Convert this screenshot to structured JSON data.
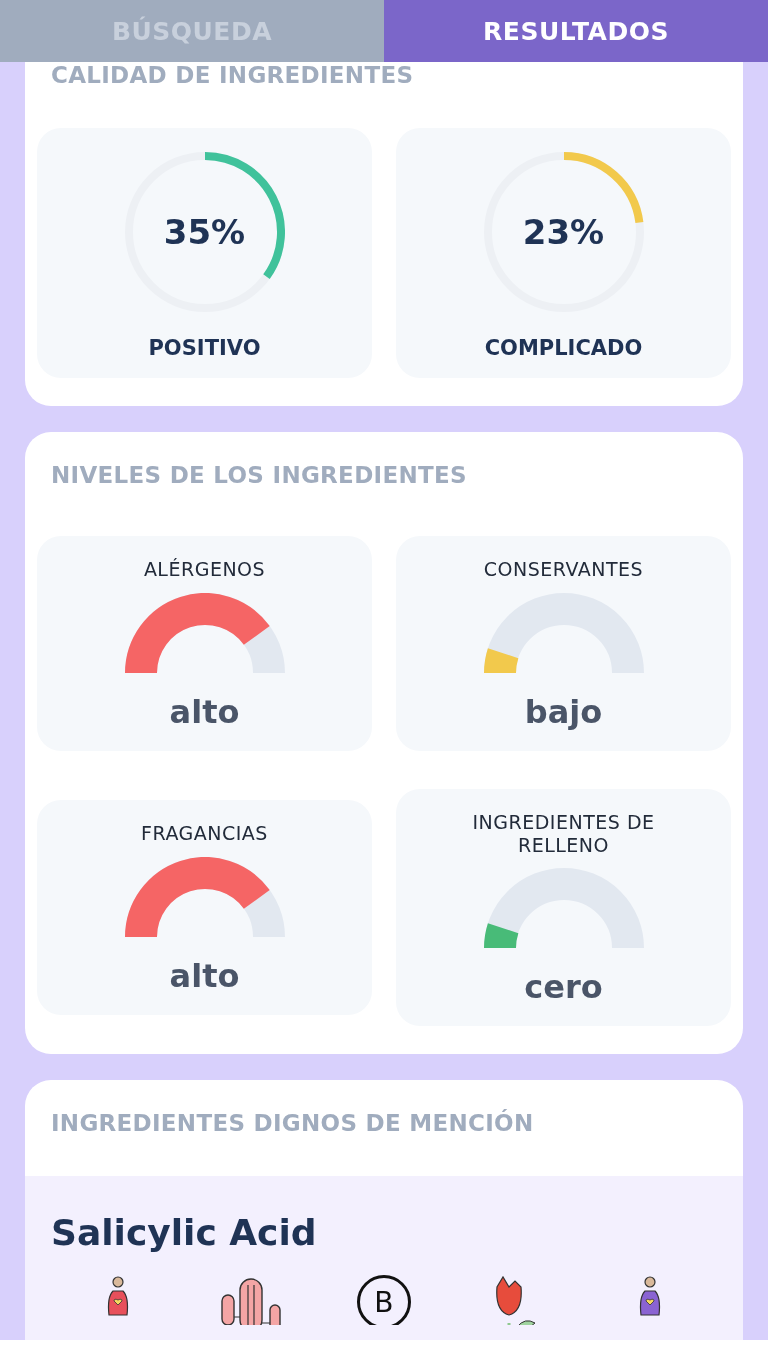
{
  "tabs": [
    {
      "label": "BÚSQUEDA",
      "selected": false
    },
    {
      "label": "RESULTADOS",
      "selected": true
    }
  ],
  "quality": {
    "title": "CALIDAD DE INGREDIENTES",
    "rings": [
      {
        "value": "35%",
        "label": "POSITIVO",
        "color": "#40c29b"
      },
      {
        "value": "23%",
        "label": "COMPLICADO",
        "color": "#f2c94c"
      }
    ]
  },
  "levels": {
    "title": "NIVELES DE LOS INGREDIENTES",
    "gauges": [
      {
        "label": "ALÉRGENOS",
        "reading": "alto",
        "color": "#f56565"
      },
      {
        "label": "CONSERVANTES",
        "reading": "bajo",
        "color": "#f2c94c"
      },
      {
        "label": "FRAGANCIAS",
        "reading": "alto",
        "color": "#f56565"
      },
      {
        "label": "INGREDIENTES DE RELLENO",
        "reading": "cero",
        "color": "#48bb78"
      }
    ]
  },
  "notable": {
    "title": "INGREDIENTES DIGNOS DE MENCIÓN",
    "ingredient": {
      "name": "Salicylic Acid",
      "icons": [
        {
          "kind": "person",
          "color": "#e8505b"
        },
        {
          "kind": "cactus"
        },
        {
          "kind": "letter",
          "label": "B"
        },
        {
          "kind": "rose"
        },
        {
          "kind": "person",
          "color": "#8a63d2"
        }
      ]
    }
  }
}
